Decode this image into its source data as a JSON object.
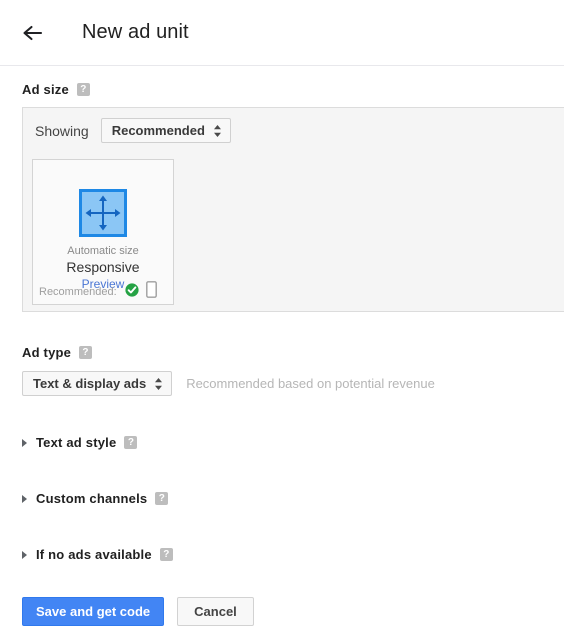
{
  "header": {
    "back_icon": "arrow-left-icon",
    "title": "New ad unit"
  },
  "ad_size": {
    "heading": "Ad size",
    "help_glyph": "?",
    "showing_label": "Showing",
    "showing_value": "Recommended",
    "card": {
      "icon": "responsive-resize-icon",
      "auto_size": "Automatic size",
      "name": "Responsive",
      "preview_link": "Preview",
      "recommended_label": "Recommended:",
      "check_icon": "green-check-circle-icon",
      "device_icon": "mobile-phone-icon"
    }
  },
  "ad_type": {
    "heading": "Ad type",
    "help_glyph": "?",
    "value": "Text & display ads",
    "note": "Recommended based on potential revenue"
  },
  "collapsibles": [
    {
      "label": "Text ad style",
      "help_glyph": "?"
    },
    {
      "label": "Custom channels",
      "help_glyph": "?"
    },
    {
      "label": "If no ads available",
      "help_glyph": "?"
    }
  ],
  "buttons": {
    "save_label": "Save and get code",
    "cancel_label": "Cancel"
  },
  "colors": {
    "primary_blue": "#4285f4",
    "link_blue": "#4a76d4",
    "icon_blue_fill": "#8bc6f5",
    "icon_blue_border": "#1e88e5",
    "green_check": "#25a244",
    "panel_gray": "#f5f5f5"
  }
}
